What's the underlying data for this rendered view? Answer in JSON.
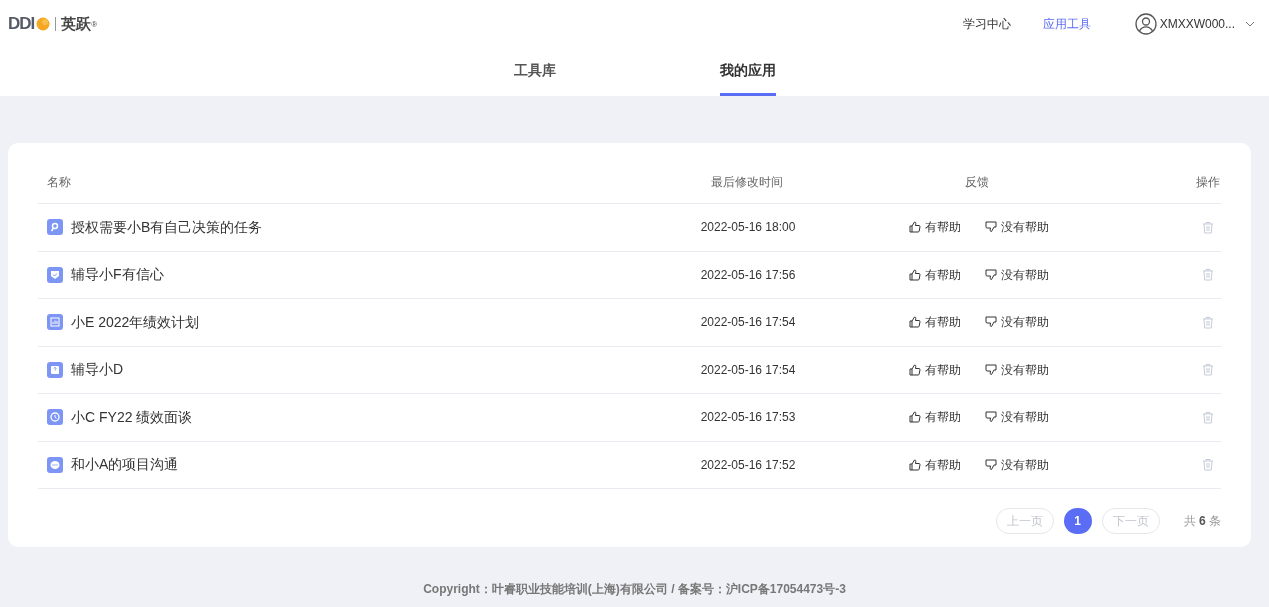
{
  "logo": {
    "brand": "DDI",
    "product": "英跃",
    "mark": "®"
  },
  "nav": [
    {
      "label": "学习中心",
      "selected": false
    },
    {
      "label": "应用工具",
      "selected": true
    }
  ],
  "user": {
    "name": "XMXXW000..."
  },
  "tabs": [
    {
      "label": "工具库",
      "selected": false
    },
    {
      "label": "我的应用",
      "selected": true
    }
  ],
  "table": {
    "columns": [
      "名称",
      "最后修改时间",
      "反馈",
      "操作"
    ],
    "rows": [
      {
        "kind": "key",
        "name": "授权需要小B有自己决策的任务",
        "time": "2022-05-16 18:00",
        "helpful": "有帮助",
        "unhelpful": "没有帮助"
      },
      {
        "kind": "shield",
        "name": "辅导小F有信心",
        "time": "2022-05-16 17:56",
        "helpful": "有帮助",
        "unhelpful": "没有帮助"
      },
      {
        "kind": "chart",
        "name": "小E 2022年绩效计划",
        "time": "2022-05-16 17:54",
        "helpful": "有帮助",
        "unhelpful": "没有帮助"
      },
      {
        "kind": "question",
        "name": "辅导小D",
        "time": "2022-05-16 17:54",
        "helpful": "有帮助",
        "unhelpful": "没有帮助"
      },
      {
        "kind": "clock",
        "name": "小C FY22 绩效面谈",
        "time": "2022-05-16 17:53",
        "helpful": "有帮助",
        "unhelpful": "没有帮助"
      },
      {
        "kind": "chat",
        "name": "和小A的项目沟通",
        "time": "2022-05-16 17:52",
        "helpful": "有帮助",
        "unhelpful": "没有帮助"
      }
    ]
  },
  "pagination": {
    "prev": {
      "label": "上一页",
      "disabled": true
    },
    "pages": [
      {
        "label": "1",
        "selected": true
      }
    ],
    "next": {
      "label": "下一页",
      "disabled": true
    },
    "total": "共 **6** 条"
  },
  "footer": "Copyright：叶睿职业技能培训(上海)有限公司 / 备案号：沪ICP备17054473号-3"
}
